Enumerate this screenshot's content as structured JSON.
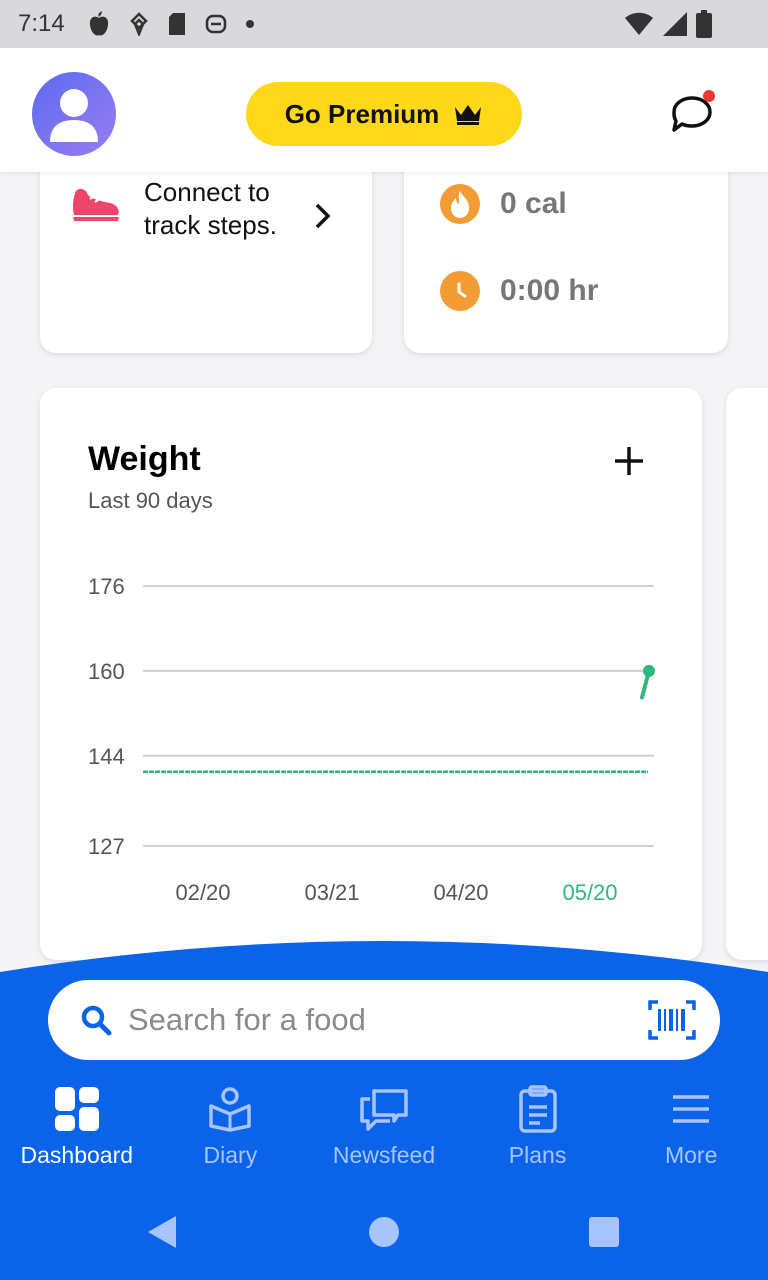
{
  "status_bar": {
    "time": "7:14"
  },
  "header": {
    "premium_label": "Go Premium"
  },
  "steps_card": {
    "text": "Connect to track steps."
  },
  "exercise_card": {
    "calories": "0 cal",
    "duration": "0:00 hr"
  },
  "weight_card": {
    "title": "Weight",
    "subtitle": "Last 90 days",
    "y_ticks": [
      "176",
      "160",
      "144",
      "127"
    ],
    "x_ticks": [
      "02/20",
      "03/21",
      "04/20",
      "05/20"
    ]
  },
  "chart_data": {
    "type": "line",
    "title": "Weight",
    "subtitle": "Last 90 days",
    "ylim": [
      127,
      176
    ],
    "y_ticks": [
      176,
      160,
      144,
      127
    ],
    "x_ticks": [
      "02/20",
      "03/21",
      "04/20",
      "05/20"
    ],
    "highlight_tick": "05/20",
    "series": [
      {
        "x": [
          "05/19",
          "05/20"
        ],
        "values": [
          155,
          160
        ],
        "color": "#2db87d"
      }
    ],
    "goal_line": {
      "value": 141,
      "color": "#2db87d",
      "style": "dashed"
    },
    "grid": true
  },
  "search": {
    "placeholder": "Search for a food"
  },
  "nav": {
    "items": [
      {
        "label": "Dashboard",
        "icon": "dashboard-icon",
        "active": true
      },
      {
        "label": "Diary",
        "icon": "diary-icon",
        "active": false
      },
      {
        "label": "Newsfeed",
        "icon": "newsfeed-icon",
        "active": false
      },
      {
        "label": "Plans",
        "icon": "plans-icon",
        "active": false
      },
      {
        "label": "More",
        "icon": "menu-icon",
        "active": false
      }
    ]
  },
  "colors": {
    "brand_blue": "#0a63e8",
    "premium_yellow": "#ffd81a",
    "chart_green": "#2db87d",
    "exercise_orange": "#f39c34",
    "steps_red": "#f0456a"
  }
}
